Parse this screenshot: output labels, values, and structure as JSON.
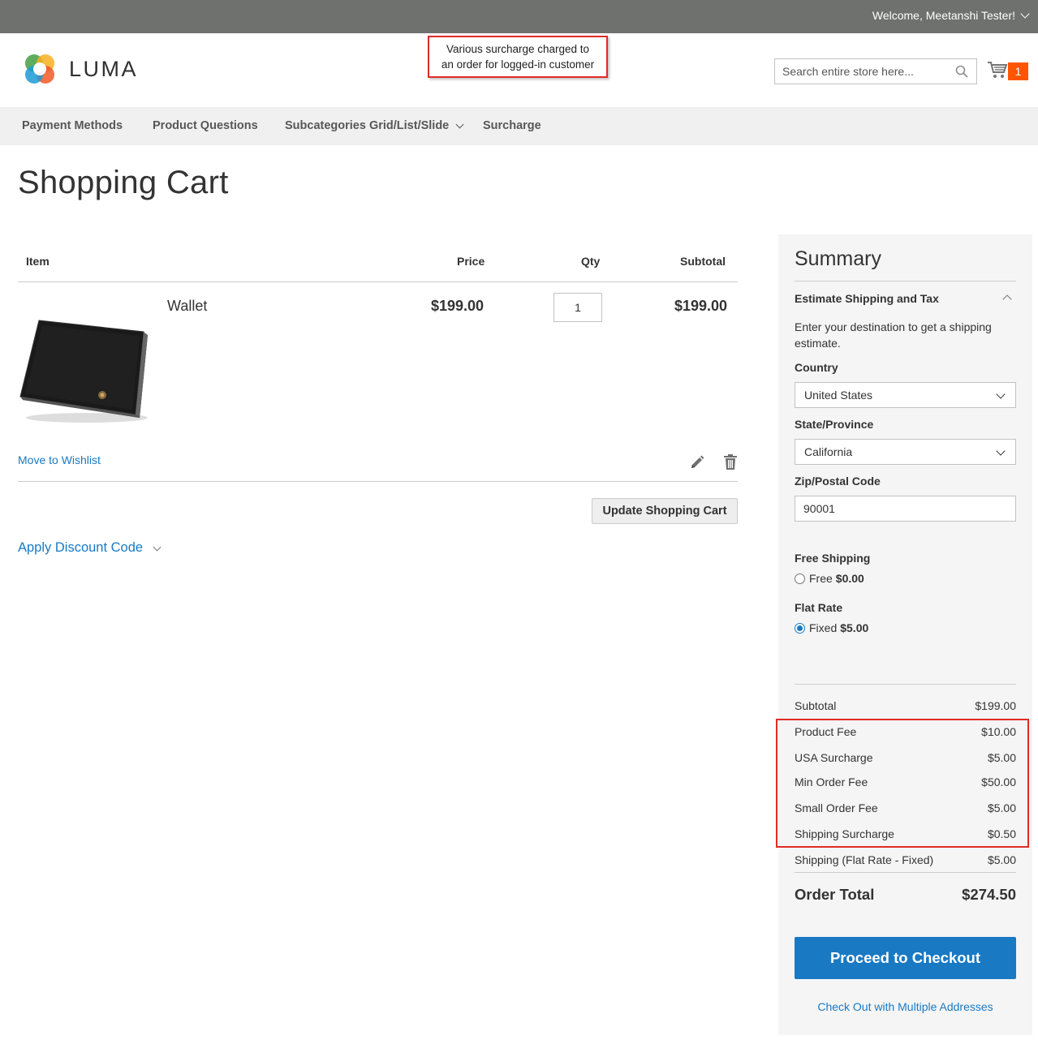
{
  "topbar": {
    "welcome": "Welcome, Meetanshi Tester!"
  },
  "header": {
    "logo_text": "LUMA",
    "annotation_line1": "Various surcharge charged to",
    "annotation_line2": "an order for logged-in customer",
    "search_placeholder": "Search entire store here...",
    "cart_count": "1"
  },
  "nav": {
    "items": [
      "Payment Methods",
      "Product Questions",
      "Subcategories Grid/List/Slide",
      "Surcharge"
    ]
  },
  "page": {
    "title": "Shopping Cart"
  },
  "cart": {
    "headers": {
      "item": "Item",
      "price": "Price",
      "qty": "Qty",
      "subtotal": "Subtotal"
    },
    "items": [
      {
        "name": "Wallet",
        "price": "$199.00",
        "qty": "1",
        "subtotal": "$199.00"
      }
    ],
    "move_to_wishlist": "Move to Wishlist",
    "update_button": "Update Shopping Cart",
    "discount_label": "Apply Discount Code"
  },
  "summary": {
    "title": "Summary",
    "estimate_title": "Estimate Shipping and Tax",
    "estimate_text": "Enter your destination to get a shipping estimate.",
    "country_label": "Country",
    "country_value": "United States",
    "state_label": "State/Province",
    "state_value": "California",
    "zip_label": "Zip/Postal Code",
    "zip_value": "90001",
    "free_shipping_title": "Free Shipping",
    "free_label": "Free",
    "free_price": "$0.00",
    "flat_rate_title": "Flat Rate",
    "fixed_label": "Fixed",
    "fixed_price": "$5.00",
    "totals": [
      {
        "label": "Subtotal",
        "value": "$199.00"
      },
      {
        "label": "Product Fee",
        "value": "$10.00"
      },
      {
        "label": "USA Surcharge",
        "value": "$5.00"
      },
      {
        "label": "Min Order Fee",
        "value": "$50.00"
      },
      {
        "label": "Small Order Fee",
        "value": "$5.00"
      },
      {
        "label": "Shipping Surcharge",
        "value": "$0.50"
      },
      {
        "label": "Shipping (Flat Rate - Fixed)",
        "value": "$5.00"
      }
    ],
    "order_total_label": "Order Total",
    "order_total_value": "$274.50",
    "checkout_button": "Proceed to Checkout",
    "multi_address": "Check Out with Multiple Addresses"
  },
  "colors": {
    "accent": "#1979c3",
    "badge": "#ff5501",
    "topbar": "#6e716e",
    "highlight": "#e02b27"
  }
}
